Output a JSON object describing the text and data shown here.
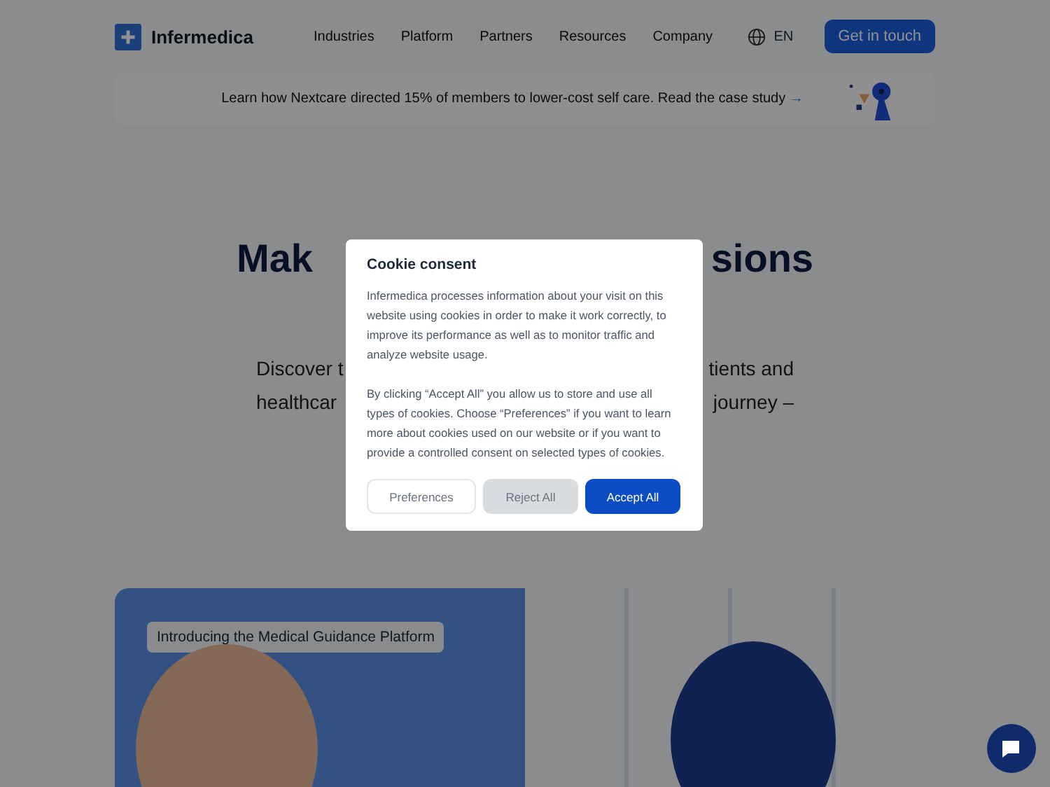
{
  "header": {
    "logo_text": "Infermedica",
    "nav": [
      {
        "label": "Industries"
      },
      {
        "label": "Platform"
      },
      {
        "label": "Partners"
      },
      {
        "label": "Resources"
      },
      {
        "label": "Company"
      }
    ],
    "language": "EN",
    "cta": "Get in touch"
  },
  "banner": {
    "text": "Learn how Nextcare directed 15% of members to lower-cost self care. Read the case study",
    "arrow": "→"
  },
  "hero": {
    "title_left": "Mak",
    "title_right": "sions",
    "subtitle_lines": [
      {
        "left": "Discover t",
        "right": "tients and"
      },
      {
        "left": "healthcar",
        "right": "journey –"
      }
    ]
  },
  "feature_card": {
    "tag": "Introducing the Medical Guidance Platform"
  },
  "cookie_dialog": {
    "title": "Cookie consent",
    "paragraphs": [
      "Infermedica processes information about your visit on this website using cookies in order to make it work correctly, to improve its performance as well as to monitor traffic and analyze website usage.",
      "By clicking “Accept All” you allow us to store and use all types of cookies. Choose “Preferences” if you want to learn more about cookies used on our website or if you want to provide a controlled consent on selected types of cookies."
    ],
    "buttons": [
      {
        "label": "Preferences",
        "kind": "outline"
      },
      {
        "label": "Reject All",
        "kind": "secondary"
      },
      {
        "label": "Accept All",
        "kind": "primary"
      }
    ]
  }
}
